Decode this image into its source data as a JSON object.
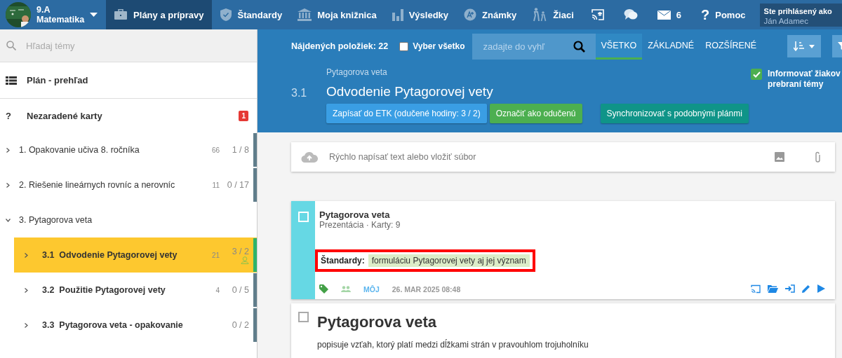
{
  "header": {
    "class_name": "9.A",
    "subject": "Matematika",
    "nav": [
      {
        "label": "Plány a prípravy",
        "selected": true
      },
      {
        "label": "Štandardy",
        "selected": false
      },
      {
        "label": "Moja knižnica",
        "selected": false
      },
      {
        "label": "Výsledky",
        "selected": false
      },
      {
        "label": "Známky",
        "selected": false
      },
      {
        "label": "Žiaci",
        "selected": false
      }
    ],
    "messages_count": "6",
    "help_mark": "?",
    "help_label": "Pomoc",
    "login_caption": "Ste prihlásený ako",
    "user_name": "Ján Adamec"
  },
  "sidebar": {
    "search": {
      "placeholder": "Hľadaj témy"
    },
    "overview": "Plán - prehľad",
    "unassigned": {
      "mark": "?",
      "label": "Nezaradené karty",
      "badge": "1"
    },
    "topics": [
      {
        "label": "1. Opakovanie učiva 8. ročníka",
        "count": "66",
        "progress": "1 / 8",
        "expanded": false,
        "selected": false,
        "color": "#607d8b"
      },
      {
        "label": "2. Riešenie lineárnych rovníc a nerovníc",
        "count": "11",
        "progress": "0 / 17",
        "expanded": false,
        "selected": false,
        "color": "#607d8b"
      },
      {
        "label": "3. Pytagorova veta",
        "expanded": true,
        "selected": false,
        "children": [
          {
            "number": "3.1",
            "label": "Odvodenie Pytagorovej vety",
            "count": "21",
            "progress": "3 / 2",
            "expanded": false,
            "selected": true,
            "locked": true,
            "color": "#2eb36a"
          },
          {
            "number": "3.2",
            "label": "Použitie Pytagorovej vety",
            "count": "4",
            "progress": "0 / 5",
            "expanded": false,
            "selected": false,
            "locked": false,
            "color": "#607d8b"
          },
          {
            "number": "3.3",
            "label": "Pytagorova veta - opakovanie",
            "progress": "0 / 2",
            "expanded": false,
            "selected": false,
            "locked": false,
            "color": "#607d8b"
          }
        ]
      }
    ]
  },
  "toolbar": {
    "found": "Nájdených položiek: 22",
    "select_all": {
      "label": "Vyber všetko",
      "checked": false
    },
    "search": {
      "placeholder": "zadajte do vyhľ"
    },
    "filters": [
      {
        "label": "VŠETKO",
        "selected": true
      },
      {
        "label": "ZÁKLADNÉ",
        "selected": false
      },
      {
        "label": "ROZŠÍRENÉ",
        "selected": false
      }
    ]
  },
  "topic_header": {
    "breadcrumb": "Pytagorova veta",
    "number": "3.1",
    "title": "Odvodenie Pytagorovej vety",
    "buttons": [
      {
        "label": "Zapísať do ETK (odučené hodiny: 3 / 2)",
        "kind": "primary"
      },
      {
        "label": "Označiť ako odučenú",
        "kind": "success"
      },
      {
        "label": "Synchronizovať s podobnými plánmi",
        "kind": "teal"
      }
    ],
    "notify": {
      "label": "Informovať žiakov prebraní témy",
      "checked": true
    }
  },
  "composer": {
    "placeholder": "Rýchlo napísať text alebo vložiť súbor"
  },
  "cards": [
    {
      "kind": "material",
      "checked": false,
      "title": "Pytagorova veta",
      "meta": "Prezentácia · Karty: 9",
      "standards_label": "Štandardy:",
      "standard": "formuláciu Pytagorovej vety aj jej význam",
      "highlighted": true,
      "owner": "MÔJ",
      "date": "26. MAR 2025 08:48"
    },
    {
      "kind": "text",
      "checked": false,
      "title": "Pytagorova veta",
      "text": "popisuje vzťah, ktorý platí medzi dĺžkami strán v pravouhlom trojuholníku"
    }
  ]
}
